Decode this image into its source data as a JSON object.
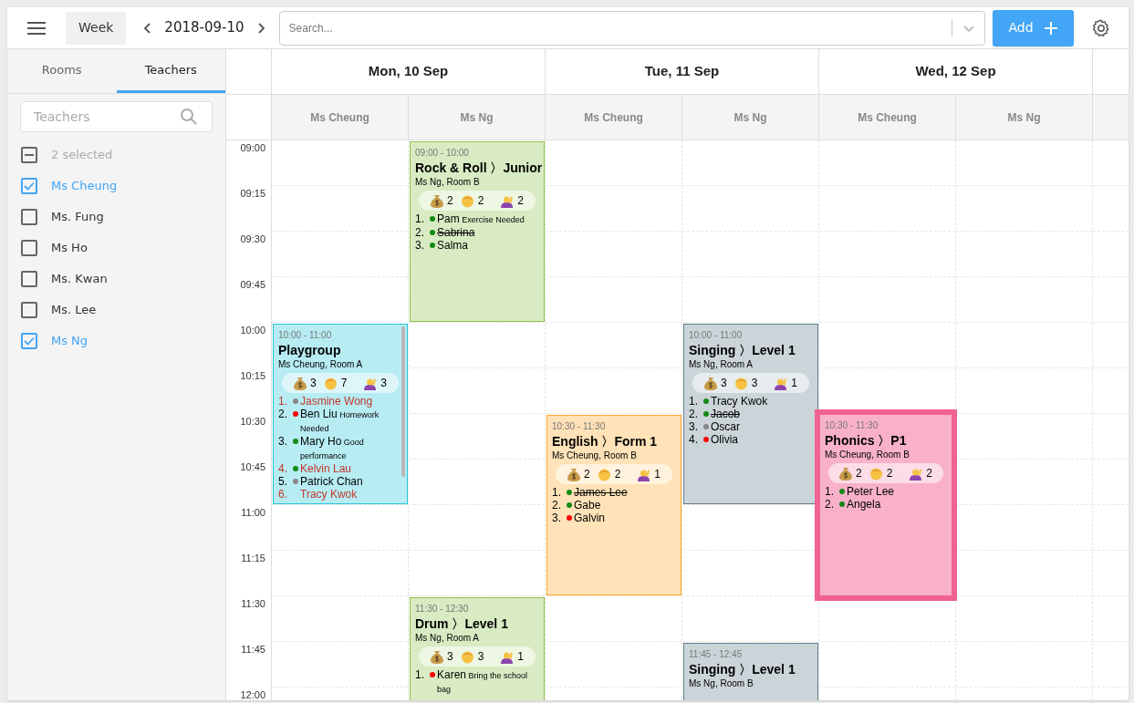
{
  "toolbar": {
    "view_button": "Week",
    "date": "2018-09-10",
    "search": {
      "placeholder": "Search..."
    },
    "add_button": "Add"
  },
  "sidebar": {
    "tabs": [
      {
        "label": "Rooms",
        "selected": false
      },
      {
        "label": "Teachers",
        "selected": true
      }
    ],
    "search": {
      "placeholder": "Teachers"
    },
    "select_all": {
      "label": "2 selected",
      "indeterminate": true
    },
    "teachers": [
      {
        "name": "Ms Cheung",
        "checked": true
      },
      {
        "name": "Ms. Fung",
        "checked": false
      },
      {
        "name": "Ms Ho",
        "checked": false
      },
      {
        "name": "Ms. Kwan",
        "checked": false
      },
      {
        "name": "Ms. Lee",
        "checked": false
      },
      {
        "name": "Ms Ng",
        "checked": true
      }
    ]
  },
  "times": [
    "09:00",
    "09:15",
    "09:30",
    "09:45",
    "10:00",
    "10:15",
    "10:30",
    "10:45",
    "11:00",
    "11:15",
    "11:30",
    "11:45",
    "12:00"
  ],
  "days": [
    {
      "label": "Mon, 10 Sep",
      "teachers": [
        {
          "name": "Ms Cheung",
          "events": [
            {
              "time": "10:00 - 11:00",
              "title": "Playgroup",
              "place": "Ms Cheung, Room A",
              "color": "#26c6da",
              "selected": false,
              "stats": [
                "3",
                "7",
                "3"
              ],
              "scrollable": true,
              "students": [
                {
                  "number": "1.",
                  "name": "Jasmine Wong",
                  "color": "#888888",
                  "flagged": true,
                  "struck": false
                },
                {
                  "number": "2.",
                  "name": "Ben Liu",
                  "note": "Homework Needed",
                  "color": "#ff0000",
                  "flagged": false,
                  "struck": false
                },
                {
                  "number": "3.",
                  "name": "Mary Ho",
                  "note": "Good performance",
                  "color": "#138a13",
                  "flagged": false,
                  "struck": false
                },
                {
                  "number": "4.",
                  "name": "Kelvin Lau",
                  "color": "#138a13",
                  "flagged": true,
                  "struck": false
                },
                {
                  "number": "5.",
                  "name": "Patrick Chan",
                  "color": "#888888",
                  "flagged": false,
                  "struck": false
                },
                {
                  "number": "6.",
                  "name": "Tracy Kwok",
                  "flagged": true,
                  "struck": false
                }
              ]
            }
          ]
        },
        {
          "name": "Ms Ng",
          "events": [
            {
              "time": "09:00 - 10:00",
              "title": "Rock & Roll 〉Junior",
              "place": "Ms Ng, Room B",
              "color": "#8bc34a",
              "selected": false,
              "stats": [
                "2",
                "2",
                "2"
              ],
              "scrollable": false,
              "students": [
                {
                  "number": "1.",
                  "name": "Pam",
                  "note": "Exercise Needed",
                  "color": "#138a13",
                  "flagged": false,
                  "struck": false
                },
                {
                  "number": "2.",
                  "name": "Sabrina",
                  "color": "#138a13",
                  "flagged": false,
                  "struck": true
                },
                {
                  "number": "3.",
                  "name": "Salma",
                  "color": "#138a13",
                  "flagged": false,
                  "struck": false
                }
              ]
            },
            {
              "time": "11:30 - 12:30",
              "title": "Drum 〉Level 1",
              "place": "Ms Ng, Room A",
              "color": "#8bc34a",
              "selected": false,
              "stats": [
                "3",
                "3",
                "1"
              ],
              "scrollable": false,
              "students": [
                {
                  "number": "1.",
                  "name": "Karen",
                  "note": "Bring the school bag",
                  "color": "#ff0000",
                  "flagged": false,
                  "struck": false
                }
              ]
            }
          ]
        }
      ]
    },
    {
      "label": "Tue, 11 Sep",
      "teachers": [
        {
          "name": "Ms Cheung",
          "events": [
            {
              "time": "10:30 - 11:30",
              "title": "English 〉Form 1",
              "place": "Ms Cheung, Room B",
              "color": "#ffa726",
              "selected": false,
              "stats": [
                "2",
                "2",
                "1"
              ],
              "scrollable": false,
              "students": [
                {
                  "number": "1.",
                  "name": "James Lee",
                  "color": "#138a13",
                  "flagged": false,
                  "struck": true
                },
                {
                  "number": "2.",
                  "name": "Gabe",
                  "color": "#138a13",
                  "flagged": false,
                  "struck": false
                },
                {
                  "number": "3.",
                  "name": "Galvin",
                  "color": "#ff0000",
                  "flagged": false,
                  "struck": false
                }
              ]
            }
          ]
        },
        {
          "name": "Ms Ng",
          "events": [
            {
              "time": "10:00 - 11:00",
              "title": "Singing 〉Level 1",
              "place": "Ms Ng, Room A",
              "color": "#607d8b",
              "selected": false,
              "stats": [
                "3",
                "3",
                "1"
              ],
              "scrollable": false,
              "students": [
                {
                  "number": "1.",
                  "name": "Tracy Kwok",
                  "color": "#138a13",
                  "flagged": false,
                  "struck": false
                },
                {
                  "number": "2.",
                  "name": "Jacob",
                  "color": "#138a13",
                  "flagged": false,
                  "struck": true
                },
                {
                  "number": "3.",
                  "name": "Oscar",
                  "color": "#888888",
                  "flagged": false,
                  "struck": false
                },
                {
                  "number": "4.",
                  "name": "Olivia",
                  "color": "#ff0000",
                  "flagged": false,
                  "struck": false
                }
              ]
            },
            {
              "time": "11:45 - 12:45",
              "title": "Singing 〉Level 1",
              "place": "Ms Ng, Room B",
              "color": "#607d8b",
              "selected": false,
              "scrollable": false
            }
          ]
        }
      ]
    },
    {
      "label": "Wed, 12 Sep",
      "teachers": [
        {
          "name": "Ms Cheung",
          "events": [
            {
              "time": "10:30 - 11:30",
              "title": "Phonics 〉P1",
              "place": "Ms Cheung, Room B",
              "color": "#f06292",
              "selected": true,
              "stats": [
                "2",
                "2",
                "2"
              ],
              "scrollable": false,
              "students": [
                {
                  "number": "1.",
                  "name": "Peter Lee",
                  "color": "#138a13",
                  "flagged": false,
                  "struck": false
                },
                {
                  "number": "2.",
                  "name": "Angela",
                  "color": "#138a13",
                  "flagged": false,
                  "struck": false
                }
              ]
            }
          ]
        },
        {
          "name": "Ms Ng"
        }
      ]
    }
  ]
}
